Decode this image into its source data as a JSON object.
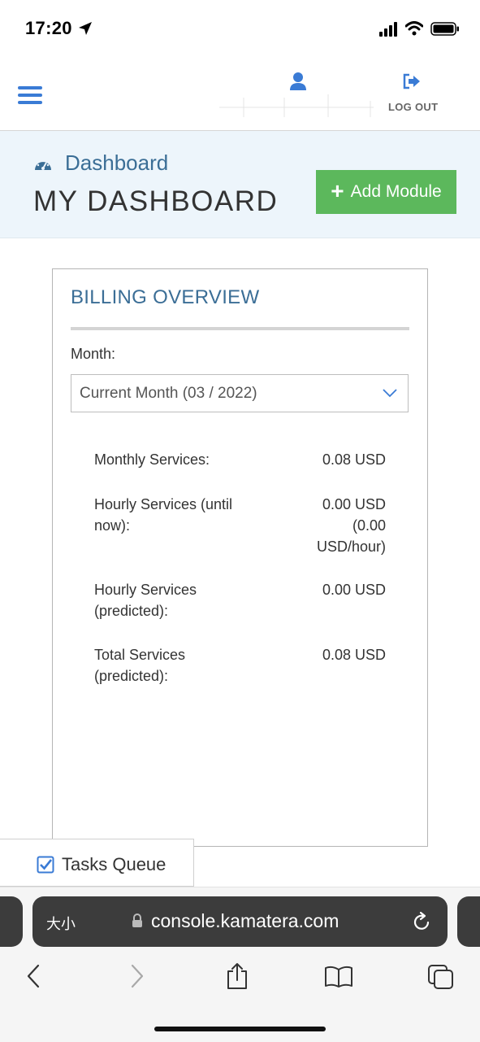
{
  "status_bar": {
    "time": "17:20"
  },
  "header": {
    "logout_label": "LOG OUT"
  },
  "dashboard": {
    "breadcrumb": "Dashboard",
    "title": "MY DASHBOARD",
    "add_module_label": "Add Module"
  },
  "billing": {
    "title": "BILLING OVERVIEW",
    "month_label": "Month:",
    "month_value": "Current Month (03 / 2022)",
    "rows": [
      {
        "label_lines": [
          "Monthly Services:"
        ],
        "value_lines": [
          "0.08 USD"
        ]
      },
      {
        "label_lines": [
          "Hourly Services (until",
          "now):"
        ],
        "value_lines": [
          "0.00 USD",
          "(0.00",
          "USD/hour)"
        ]
      },
      {
        "label_lines": [
          "Hourly Services",
          "(predicted):"
        ],
        "value_lines": [
          "0.00 USD"
        ]
      },
      {
        "label_lines": [
          "Total Services",
          "(predicted):"
        ],
        "value_lines": [
          "0.08 USD"
        ]
      }
    ]
  },
  "tasks_queue": {
    "label": "Tasks Queue"
  },
  "browser": {
    "text_size_label": "大小",
    "url": "console.kamatera.com"
  },
  "colors": {
    "brand_blue": "#3a7bd5",
    "heading_blue": "#3b6e96",
    "add_green": "#5cb85c",
    "band_bg": "#edf5fb"
  }
}
